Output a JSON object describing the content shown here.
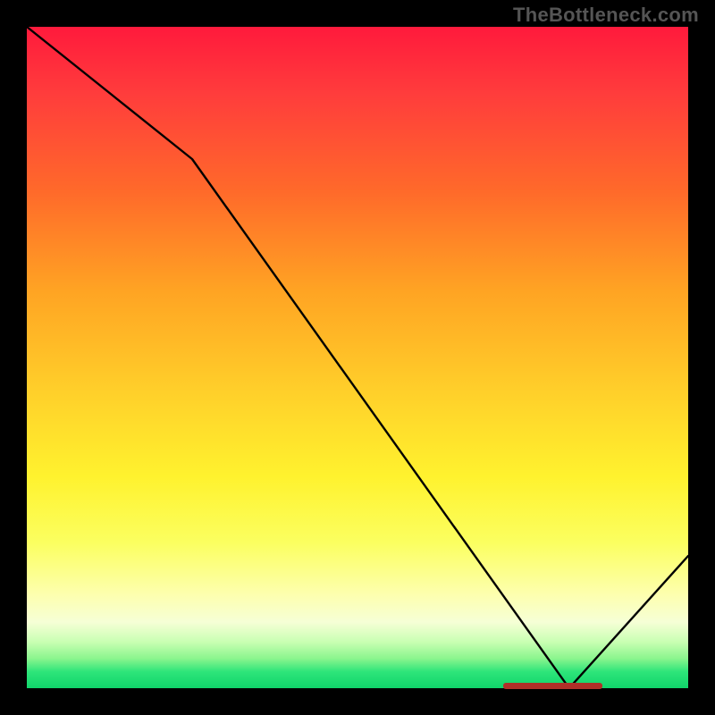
{
  "watermark": "TheBottleneck.com",
  "chart_data": {
    "type": "line",
    "title": "",
    "xlabel": "",
    "ylabel": "",
    "xlim": [
      0,
      100
    ],
    "ylim": [
      0,
      100
    ],
    "x": [
      0,
      25,
      82,
      100
    ],
    "values": [
      100,
      80,
      0,
      20
    ],
    "optimum_marker": {
      "x_start": 72,
      "x_end": 87,
      "y": 0
    },
    "gradient_stops": [
      {
        "pos": 0,
        "color": "#ff1a3c"
      },
      {
        "pos": 0.55,
        "color": "#ffcf2a"
      },
      {
        "pos": 0.86,
        "color": "#fdffb0"
      },
      {
        "pos": 1.0,
        "color": "#10d46a"
      }
    ]
  }
}
